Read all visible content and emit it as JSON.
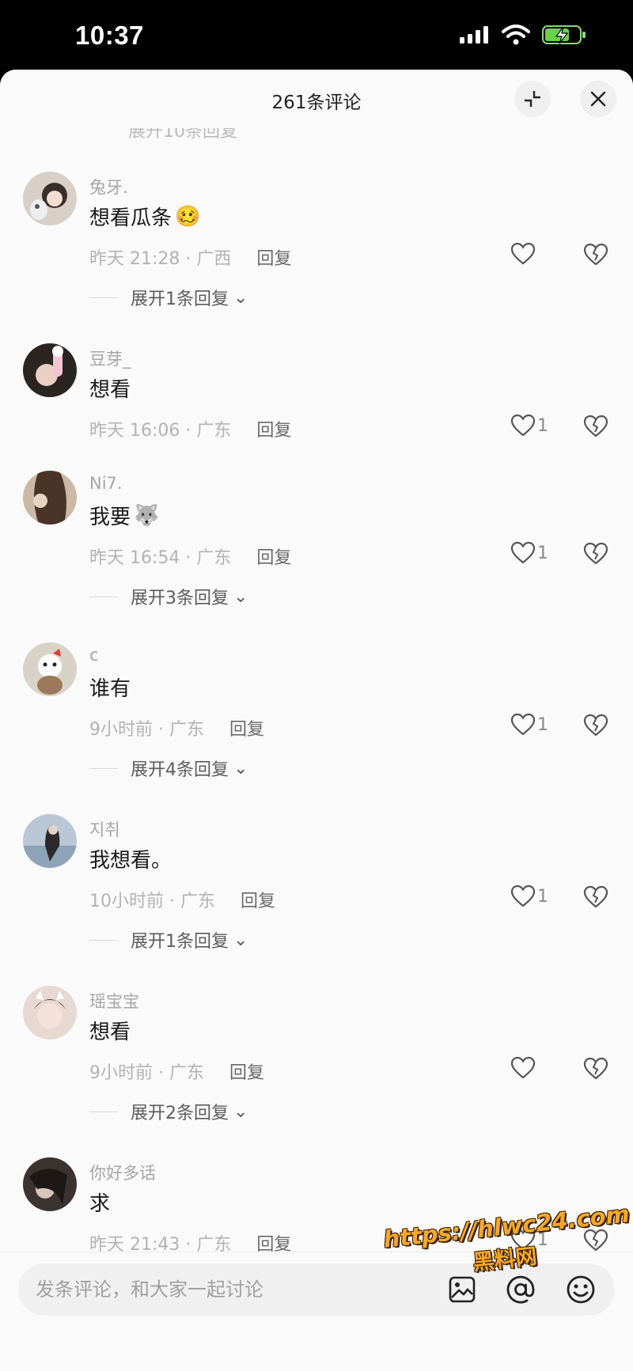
{
  "status_bar": {
    "time": "10:37"
  },
  "header": {
    "title": "261条评论",
    "peek_text": "展开10条回复"
  },
  "comments": [
    {
      "username": "兔牙.",
      "text": "想看瓜条",
      "emoji": "🥴",
      "meta": "昨天 21:28 · 广西",
      "reply": "回复",
      "likes": "",
      "expand": "展开1条回复"
    },
    {
      "username": "豆芽_",
      "text": "想看",
      "emoji": "",
      "meta": "昨天 16:06 · 广东",
      "reply": "回复",
      "likes": "1",
      "expand": ""
    },
    {
      "username": "Ni7.",
      "text": "我要",
      "emoji": "🐺",
      "meta": "昨天 16:54 · 广东",
      "reply": "回复",
      "likes": "1",
      "expand": "展开3条回复"
    },
    {
      "username": "c",
      "text": "谁有",
      "emoji": "",
      "meta": "9小时前 · 广东",
      "reply": "回复",
      "likes": "1",
      "expand": "展开4条回复"
    },
    {
      "username": "지취",
      "text": "我想看。",
      "emoji": "",
      "meta": "10小时前 · 广东",
      "reply": "回复",
      "likes": "1",
      "expand": "展开1条回复"
    },
    {
      "username": "瑶宝宝",
      "text": "想看",
      "emoji": "",
      "meta": "9小时前 · 广东",
      "reply": "回复",
      "likes": "",
      "expand": "展开2条回复"
    },
    {
      "username": "你好多话",
      "text": "求",
      "emoji": "",
      "meta": "昨天 21:43 · 广东",
      "reply": "回复",
      "likes": "1",
      "expand": ""
    }
  ],
  "input": {
    "placeholder": "发条评论，和大家一起讨论"
  },
  "icons": {
    "collapse": "collapse-icon",
    "close": "close-icon",
    "heart": "heart-icon",
    "dislike": "broken-heart-icon",
    "image": "image-icon",
    "at": "at-icon",
    "emoji": "emoji-icon"
  },
  "watermark": {
    "url": "https://hlwc24.com",
    "name": "黑料网"
  }
}
